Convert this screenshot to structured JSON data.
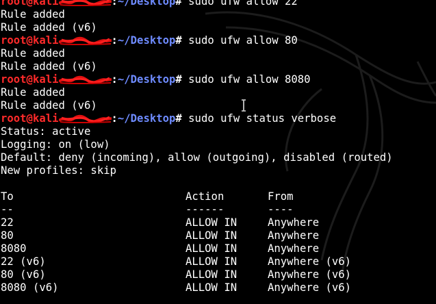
{
  "terminal": {
    "background": "#000000",
    "prompt_color": "#ff2a2a",
    "path_color": "#6e8bff",
    "text_color": "#ffffff"
  },
  "prompt": {
    "user_host": "root@kali",
    "redacted_suffix": "rwangari",
    "separator": ":",
    "path": "~/Desktop",
    "symbol": "#"
  },
  "session": {
    "cmd1": "sudo ufw allow 22",
    "cmd2": "sudo ufw allow 80",
    "cmd3": "sudo ufw allow 8080",
    "cmd4": "sudo ufw status verbose",
    "rule_added": "Rule added",
    "rule_added_v6": "Rule added (v6)",
    "status": "Status: active",
    "logging": "Logging: on (low)",
    "default": "Default: deny (incoming), allow (outgoing), disabled (routed)",
    "new_profiles": "New profiles: skip"
  },
  "table": {
    "headers": [
      "To",
      "Action",
      "From"
    ],
    "separators": [
      "--",
      "------",
      "----"
    ],
    "rows": [
      [
        "22",
        "ALLOW IN",
        "Anywhere"
      ],
      [
        "80",
        "ALLOW IN",
        "Anywhere"
      ],
      [
        "8080",
        "ALLOW IN",
        "Anywhere"
      ],
      [
        "22 (v6)",
        "ALLOW IN",
        "Anywhere (v6)"
      ],
      [
        "80 (v6)",
        "ALLOW IN",
        "Anywhere (v6)"
      ],
      [
        "8080 (v6)",
        "ALLOW IN",
        "Anywhere (v6)"
      ]
    ]
  }
}
